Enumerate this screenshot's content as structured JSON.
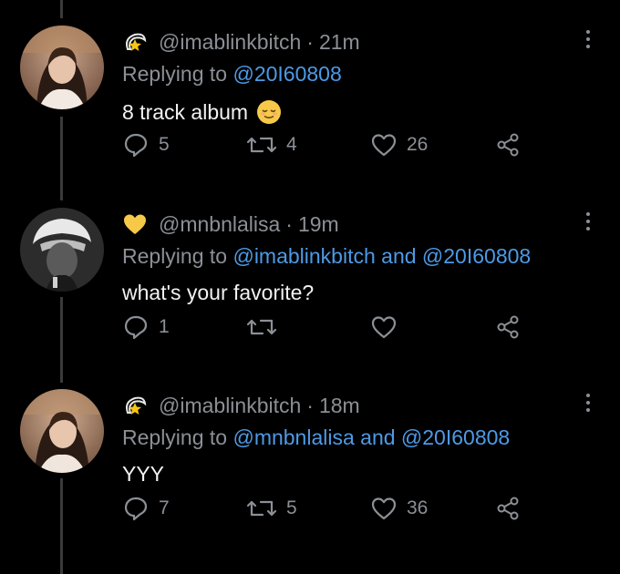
{
  "colors": {
    "background": "#000000",
    "muted": "#8b9096",
    "mention": "#4d9ae6",
    "text": "#f2f2f2",
    "thread": "#3a3a3a"
  },
  "tweets": [
    {
      "handle": "@imablinkbitch",
      "time": "21m",
      "badge_icon": "dizzy-star-icon",
      "reply_prefix": "Replying to",
      "mentions": [
        "@20I60808"
      ],
      "joiner": "",
      "text": "8 track album",
      "emoji": "relieved-face-icon",
      "reply_count": "5",
      "retweet_count": "4",
      "like_count": "26"
    },
    {
      "handle": "@mnbnlalisa",
      "time": "19m",
      "badge_icon": "yellow-heart-icon",
      "reply_prefix": "Replying to",
      "mentions": [
        "@imablinkbitch",
        "@20I60808"
      ],
      "joiner": "and",
      "text": "what's your favorite?",
      "emoji": "",
      "reply_count": "1",
      "retweet_count": "",
      "like_count": ""
    },
    {
      "handle": "@imablinkbitch",
      "time": "18m",
      "badge_icon": "dizzy-star-icon",
      "reply_prefix": "Replying to",
      "mentions": [
        "@mnbnlalisa",
        "@20I60808"
      ],
      "joiner": "and",
      "text": "YYY",
      "emoji": "",
      "reply_count": "7",
      "retweet_count": "5",
      "like_count": "36"
    }
  ]
}
